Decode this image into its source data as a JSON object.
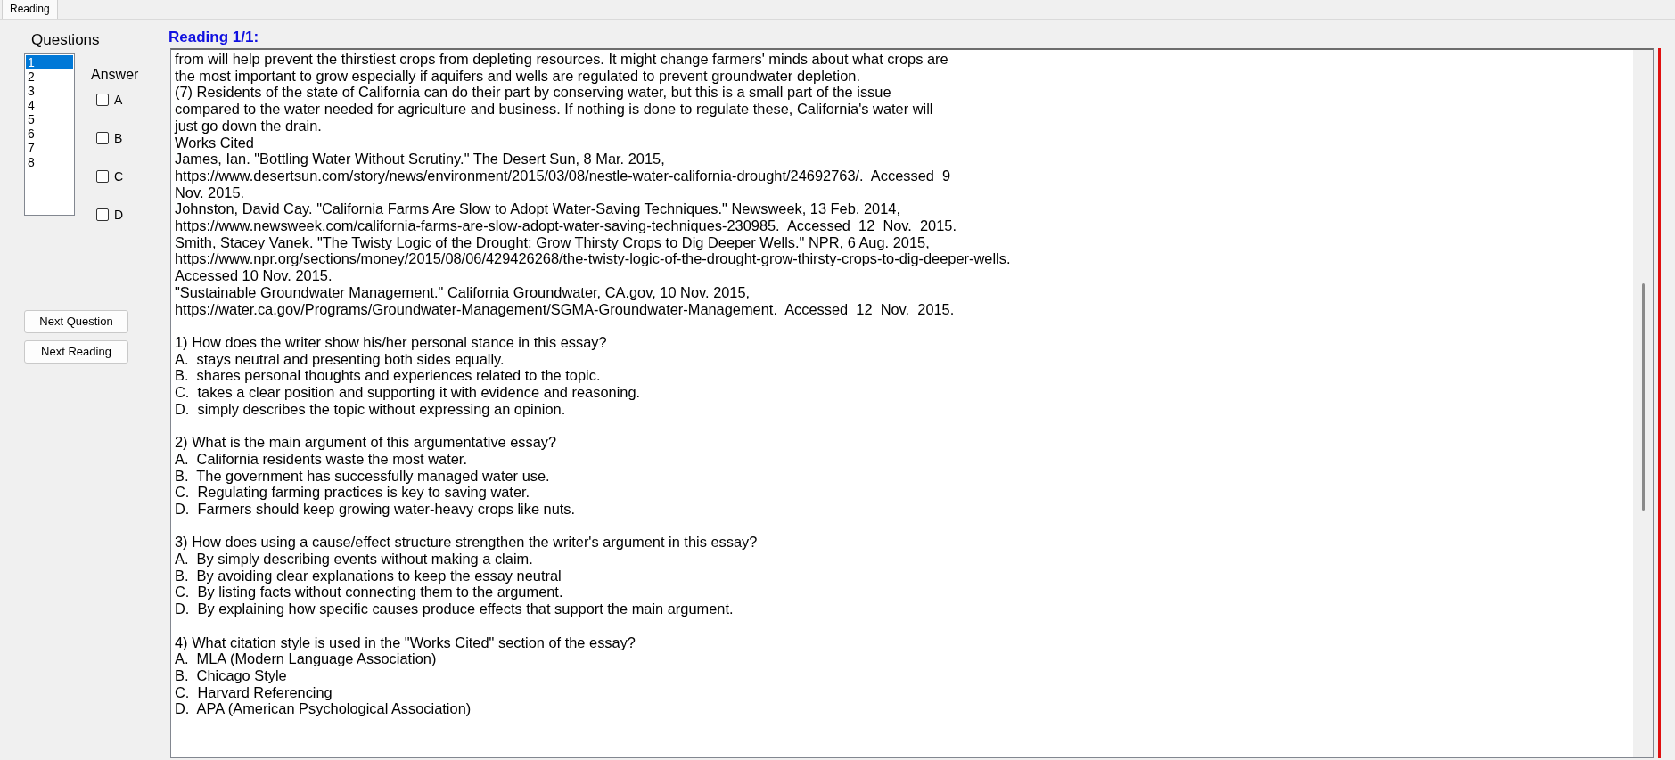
{
  "tabs": [
    {
      "label": "Reading",
      "selected": true
    }
  ],
  "questions": {
    "label": "Questions",
    "items": [
      {
        "label": "1",
        "selected": true
      },
      {
        "label": "2",
        "selected": false
      },
      {
        "label": "3",
        "selected": false
      },
      {
        "label": "4",
        "selected": false
      },
      {
        "label": "5",
        "selected": false
      },
      {
        "label": "6",
        "selected": false
      },
      {
        "label": "7",
        "selected": false
      },
      {
        "label": "8",
        "selected": false
      }
    ]
  },
  "answer": {
    "label": "Answer",
    "options": [
      {
        "label": "A",
        "checked": false
      },
      {
        "label": "B",
        "checked": false
      },
      {
        "label": "C",
        "checked": false
      },
      {
        "label": "D",
        "checked": false
      }
    ]
  },
  "buttons": [
    "Next Question",
    "Next Reading"
  ],
  "reading": {
    "title": "Reading 1/1:",
    "blocks": [
      {
        "lines": [
          "from will help prevent the thirstiest crops from depleting resources. It might change farmers' minds about what crops are",
          "the most important to grow especially if aquifers and wells are regulated to prevent groundwater depletion.",
          "(7) Residents of the state of California can do their part by conserving water, but this is a small part of the issue",
          "compared to the water needed for agriculture and business. If nothing is done to regulate these, California's water will",
          "just go down the drain.",
          "Works Cited",
          "James, Ian. \"Bottling Water Without Scrutiny.\" The Desert Sun, 8 Mar. 2015,",
          "https://www.desertsun.com/story/news/environment/2015/03/08/nestle-water-california-drought/24692763/.  Accessed  9",
          "Nov. 2015.",
          "Johnston, David Cay. \"California Farms Are Slow to Adopt Water-Saving Techniques.\" Newsweek, 13 Feb. 2014,",
          "https://www.newsweek.com/california-farms-are-slow-adopt-water-saving-techniques-230985.  Accessed  12  Nov.  2015.",
          "Smith, Stacey Vanek. \"The Twisty Logic of the Drought: Grow Thirsty Crops to Dig Deeper Wells.\" NPR, 6 Aug. 2015,",
          "https://www.npr.org/sections/money/2015/08/06/429426268/the-twisty-logic-of-the-drought-grow-thirsty-crops-to-dig-deeper-wells.",
          "Accessed 10 Nov. 2015.",
          "\"Sustainable Groundwater Management.\" California Groundwater, CA.gov, 10 Nov. 2015,",
          "https://water.ca.gov/Programs/Groundwater-Management/SGMA-Groundwater-Management.  Accessed  12  Nov.  2015."
        ]
      },
      {
        "lines": [
          "1) How does the writer show his/her personal stance in this essay?",
          "A.  stays neutral and presenting both sides equally.",
          "B.  shares personal thoughts and experiences related to the topic.",
          "C.  takes a clear position and supporting it with evidence and reasoning.",
          "D.  simply describes the topic without expressing an opinion."
        ]
      },
      {
        "lines": [
          "2) What is the main argument of this argumentative essay?",
          "A.  California residents waste the most water.",
          "B.  The government has successfully managed water use.",
          "C.  Regulating farming practices is key to saving water.",
          "D.  Farmers should keep growing water-heavy crops like nuts."
        ]
      },
      {
        "lines": [
          "3) How does using a cause/effect structure strengthen the writer's argument in this essay?",
          "A.  By simply describing events without making a claim.",
          "B.  By avoiding clear explanations to keep the essay neutral",
          "C.  By listing facts without connecting them to the argument.",
          "D.  By explaining how specific causes produce effects that support the main argument."
        ]
      },
      {
        "lines": [
          "4) What citation style is used in the \"Works Cited\" section of the essay?",
          "A.  MLA (Modern Language Association)",
          "B.  Chicago Style",
          "C.  Harvard Referencing",
          "D.  APA (American Psychological Association)"
        ]
      }
    ]
  }
}
